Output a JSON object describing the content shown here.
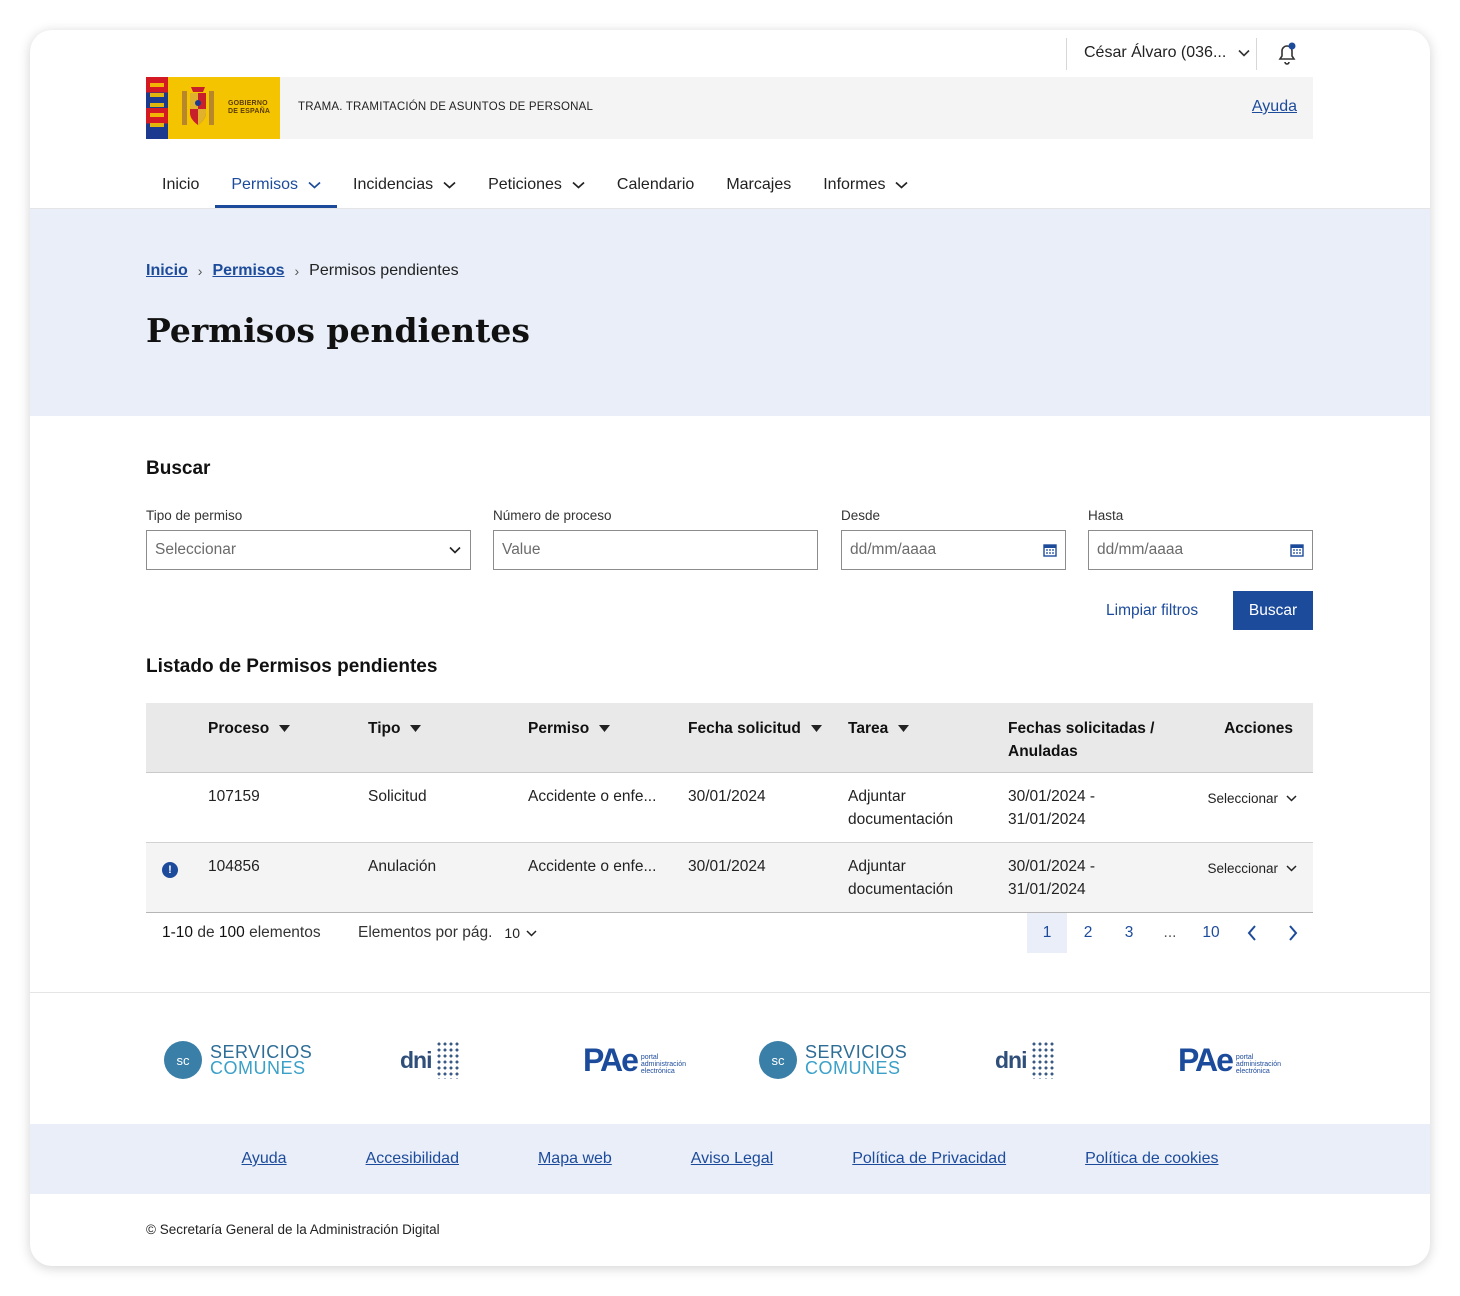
{
  "user": {
    "name": "César Álvaro (036..."
  },
  "brand": {
    "logo_text_1": "GOBIERNO",
    "logo_text_2": "DE ESPAÑA",
    "app_title": "TRAMA. TRAMITACIÓN DE ASUNTOS DE PERSONAL",
    "help": "Ayuda"
  },
  "nav": [
    {
      "label": "Inicio"
    },
    {
      "label": "Permisos"
    },
    {
      "label": "Incidencias"
    },
    {
      "label": "Peticiones"
    },
    {
      "label": "Calendario"
    },
    {
      "label": "Marcajes"
    },
    {
      "label": "Informes"
    }
  ],
  "breadcrumb": [
    "Inicio",
    "Permisos",
    "Permisos pendientes"
  ],
  "page_title": "Permisos pendientes",
  "search": {
    "title": "Buscar",
    "tipo_label": "Tipo de permiso",
    "tipo_value": "Seleccionar",
    "numero_label": "Número de proceso",
    "numero_placeholder": "Value",
    "desde_label": "Desde",
    "desde_placeholder": "dd/mm/aaaa",
    "hasta_label": "Hasta",
    "hasta_placeholder": "dd/mm/aaaa",
    "clear": "Limpiar filtros",
    "submit": "Buscar"
  },
  "list": {
    "title": "Listado de Permisos pendientes",
    "headers": {
      "proceso": "Proceso",
      "tipo": "Tipo",
      "permiso": "Permiso",
      "fecha": "Fecha solicitud",
      "tarea": "Tarea",
      "fechas_1": "Fechas solicitadas /",
      "fechas_2": "Anuladas",
      "acciones": "Acciones"
    },
    "rows": [
      {
        "proceso": "107159",
        "tipo": "Solicitud",
        "permiso": "Accidente o enfe...",
        "fecha": "30/01/2024",
        "tarea_1": "Adjuntar",
        "tarea_2": "documentación",
        "fechas_1": "30/01/2024 -",
        "fechas_2": "31/01/2024",
        "accion": "Seleccionar",
        "alert": ""
      },
      {
        "proceso": "104856",
        "tipo": "Anulación",
        "permiso": "Accidente o enfe...",
        "fecha": "30/01/2024",
        "tarea_1": "Adjuntar",
        "tarea_2": "documentación",
        "fechas_1": "30/01/2024 -",
        "fechas_2": "31/01/2024",
        "accion": "Seleccionar",
        "alert": "!"
      }
    ]
  },
  "pagination": {
    "range": "1-10",
    "of": "de",
    "total": "100",
    "elements": "elementos",
    "per_page_label": "Elementos por pág.",
    "per_page_value": "10",
    "pages": [
      "1",
      "2",
      "3",
      "...",
      "10"
    ],
    "current": "1"
  },
  "logos": {
    "sc_1": "SERVICIOS",
    "sc_2": "COMUNES",
    "sc_mark": "sc",
    "dni": "dni",
    "pae": "PAe",
    "pae_sub_1": "portal",
    "pae_sub_2": "administración",
    "pae_sub_3": "electrónica"
  },
  "footer": {
    "links": [
      "Ayuda",
      "Accesibilidad",
      "Mapa web",
      "Aviso Legal",
      "Política de Privacidad",
      "Política de cookies"
    ],
    "copyright": "© Secretaría General de la Administración Digital"
  },
  "colors": {
    "primary": "#1d4b9b",
    "hero_bg": "#e9eef8",
    "table_head": "#e9e9e9"
  }
}
